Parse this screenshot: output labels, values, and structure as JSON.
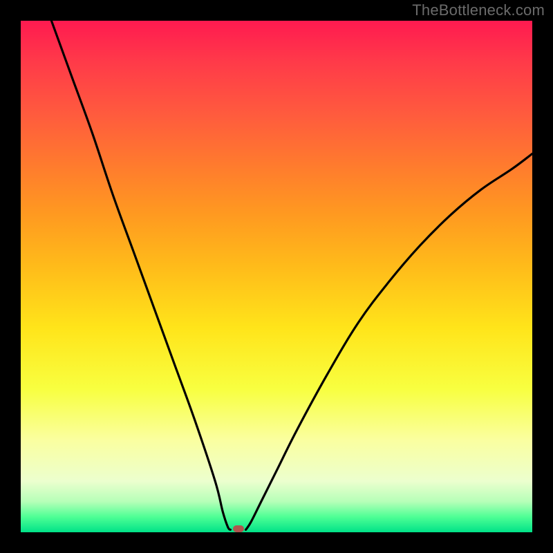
{
  "watermark": "TheBottleneck.com",
  "chart_data": {
    "type": "line",
    "title": "",
    "xlabel": "",
    "ylabel": "",
    "xlim": [
      0,
      100
    ],
    "ylim": [
      0,
      100
    ],
    "series": [
      {
        "name": "bottleneck-curve-left",
        "x": [
          6,
          10,
          14,
          18,
          22,
          26,
          30,
          34,
          38,
          39.5,
          40.5,
          41
        ],
        "y": [
          100,
          89,
          78,
          66,
          55,
          44,
          33,
          22,
          10,
          4,
          1,
          0.5
        ]
      },
      {
        "name": "bottleneck-curve-right",
        "x": [
          44,
          45,
          47,
          50,
          54,
          60,
          66,
          72,
          78,
          84,
          90,
          96,
          100
        ],
        "y": [
          0.5,
          2,
          6,
          12,
          20,
          31,
          41,
          49,
          56,
          62,
          67,
          71,
          74
        ]
      }
    ],
    "marker": {
      "x": 42.5,
      "y": 0.7
    },
    "gradient_stops": [
      {
        "pos": 0,
        "color": "#ff1a50"
      },
      {
        "pos": 50,
        "color": "#ffd21a"
      },
      {
        "pos": 100,
        "color": "#00e288"
      }
    ]
  }
}
